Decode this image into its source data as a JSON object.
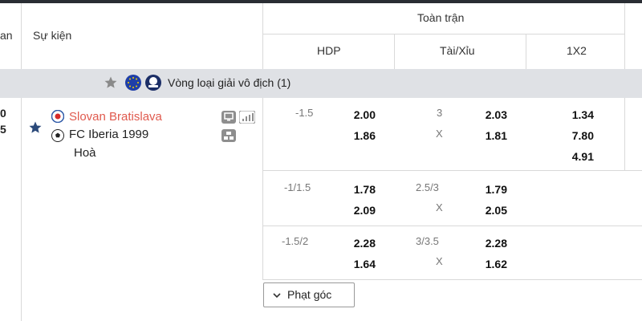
{
  "header": {
    "partial_left": "an",
    "event_label": "Sự kiện",
    "fulltime_label": "Toàn trận",
    "cols": {
      "hdp": "HDP",
      "ou": "Tài/Xỉu",
      "x12": "1X2"
    }
  },
  "league": {
    "name": "Vòng loại giải vô địch (1)"
  },
  "match": {
    "score_partial": {
      "top": "0",
      "bottom": "5"
    },
    "home": "Slovan Bratislava",
    "away": "FC Iberia 1999",
    "draw": "Hoà",
    "home_color": "#e05a4e"
  },
  "markets": [
    {
      "hdp_line": "-1.5",
      "hdp_home": "2.00",
      "hdp_away": "1.86",
      "ou_line": "3",
      "ou_x": "X",
      "ou_over": "2.03",
      "ou_under": "1.81",
      "x12": [
        "1.34",
        "7.80",
        "4.91"
      ]
    },
    {
      "hdp_line": "-1/1.5",
      "hdp_home": "1.78",
      "hdp_away": "2.09",
      "ou_line": "2.5/3",
      "ou_x": "X",
      "ou_over": "1.79",
      "ou_under": "2.05"
    },
    {
      "hdp_line": "-1.5/2",
      "hdp_home": "2.28",
      "hdp_away": "1.64",
      "ou_line": "3/3.5",
      "ou_x": "X",
      "ou_over": "2.28",
      "ou_under": "1.62"
    }
  ],
  "corner_button": {
    "label": "Phạt góc"
  },
  "icons": [
    "star-icon",
    "eu-flag-icon",
    "league-logo-icon",
    "slovan-badge-icon",
    "football-icon",
    "tv-icon",
    "signal-icon",
    "bracket-icon",
    "chevron-down-icon"
  ]
}
